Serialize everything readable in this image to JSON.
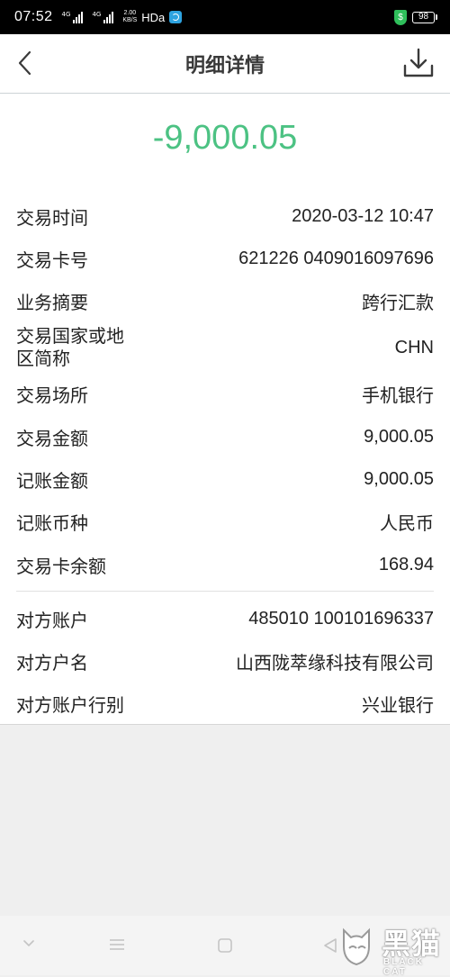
{
  "status_bar": {
    "time": "07:52",
    "signal1_label": "4G",
    "signal2_label": "4G",
    "net_speed_value": "2.00",
    "net_speed_unit": "KB/S",
    "hd_label": "HDa",
    "shield_symbol": "$",
    "battery_level": "98"
  },
  "header": {
    "title": "明细详情",
    "back_icon": "chevron-left-icon",
    "download_icon": "download-icon"
  },
  "transaction": {
    "amount": "-9,000.05",
    "amount_color": "#4cc283",
    "fields": [
      {
        "label": "交易时间",
        "value": "2020-03-12 10:47"
      },
      {
        "label": "交易卡号",
        "value": "621226 0409016097696"
      },
      {
        "label": "业务摘要",
        "value": "跨行汇款"
      },
      {
        "label": "交易国家或地区简称",
        "label_line1": "交易国家或地",
        "label_line2": "区简称",
        "value": "CHN"
      },
      {
        "label": "交易场所",
        "value": "手机银行"
      },
      {
        "label": "交易金额",
        "value": "9,000.05"
      },
      {
        "label": "记账金额",
        "value": "9,000.05"
      },
      {
        "label": "记账币种",
        "value": "人民币"
      },
      {
        "label": "交易卡余额",
        "value": "168.94"
      }
    ],
    "counterparty": [
      {
        "label": "对方账户",
        "value": "485010 100101696337"
      },
      {
        "label": "对方户名",
        "value": "山西陇萃缘科技有限公司"
      },
      {
        "label": "对方账户行别",
        "value": "兴业银行"
      }
    ]
  },
  "bottom_nav": {
    "icons": [
      "chevron-down-icon",
      "menu-icon",
      "home-square-icon",
      "back-triangle-icon"
    ]
  },
  "watermark": {
    "chinese": "黑猫",
    "english": "BLACK CAT"
  }
}
